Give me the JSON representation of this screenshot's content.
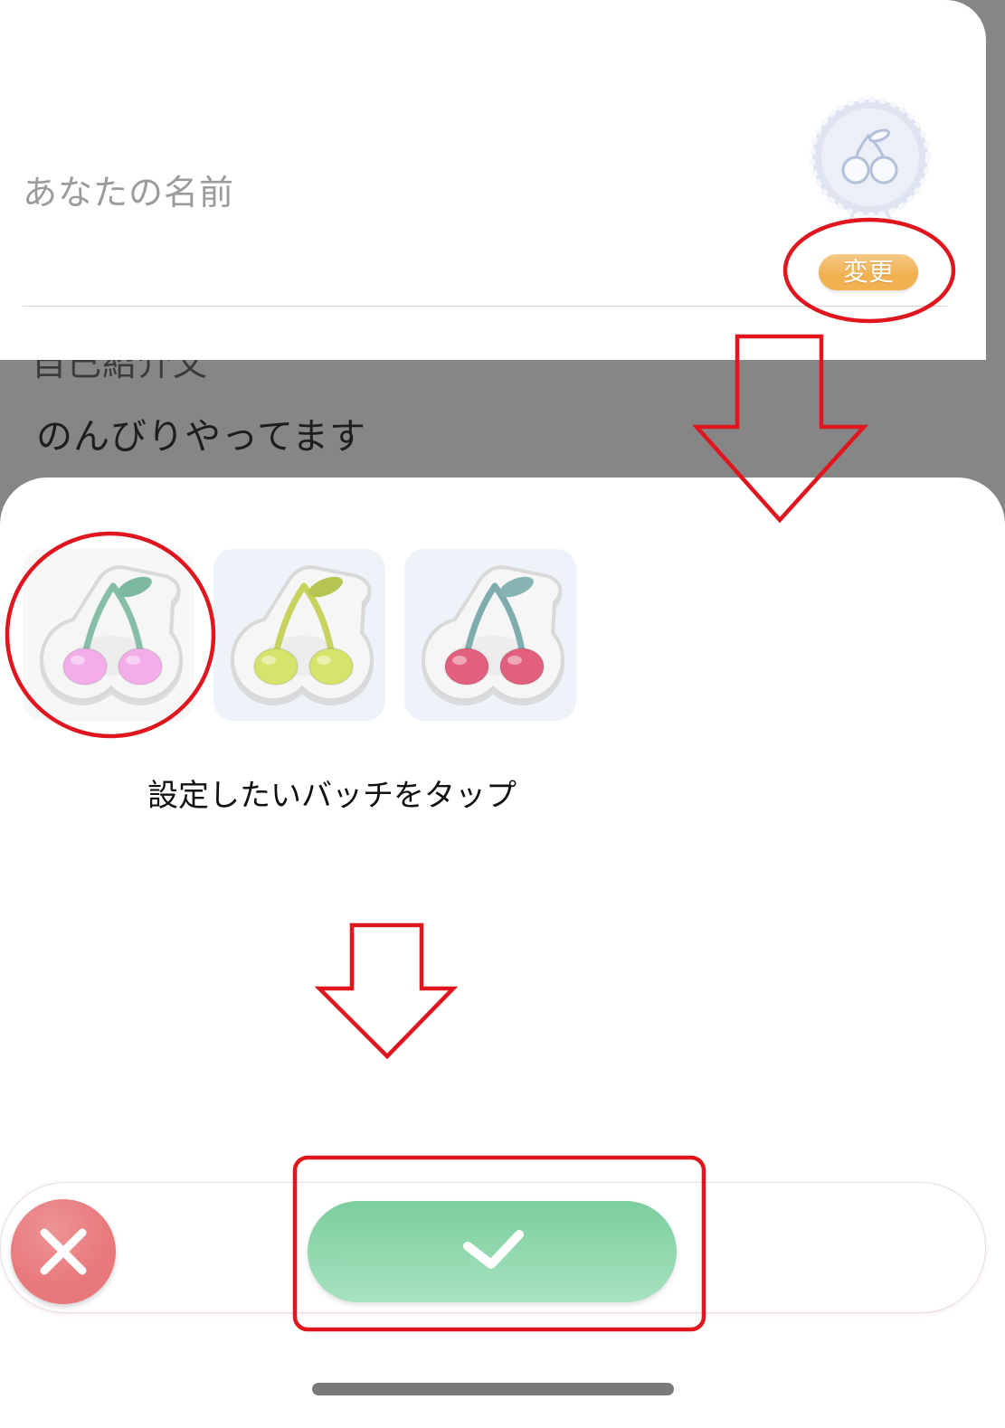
{
  "profile_card": {
    "name_placeholder": "あなたの名前",
    "avatar_icon": "cherry-badge-icon",
    "change_button_label": "変更"
  },
  "profile_background": {
    "intro_label": "自己紹介文",
    "intro_text": "のんびりやってます"
  },
  "badge_sheet": {
    "badges": [
      {
        "icon": "cherry-pink-badge-icon",
        "cherry_color": "#f3aeea",
        "stem_color": "#86bea8",
        "leaf_color": "#7db8a1",
        "selected": true
      },
      {
        "icon": "cherry-yellow-badge-icon",
        "cherry_color": "#d6e46c",
        "stem_color": "#c7d35e",
        "leaf_color": "#b5c54f",
        "selected": false
      },
      {
        "icon": "cherry-red-badge-icon",
        "cherry_color": "#e2607e",
        "stem_color": "#7fadae",
        "leaf_color": "#86b4b3",
        "selected": false
      }
    ],
    "instruction": "設定したいバッチをタップ"
  },
  "action_bar": {
    "cancel_icon": "close-icon",
    "confirm_icon": "check-icon"
  },
  "colors": {
    "backdrop": "#868686",
    "change_button": "#f1b150",
    "cancel_button": "#e8787b",
    "confirm_button": "#80d5a3",
    "annotation": "#e0161f"
  }
}
